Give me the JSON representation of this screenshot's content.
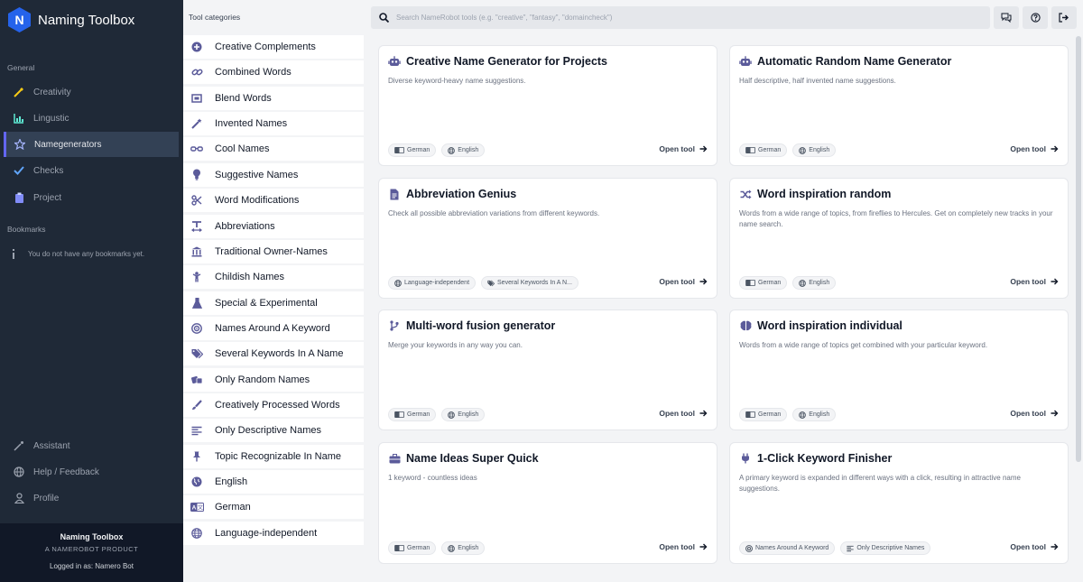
{
  "sidebar": {
    "app_name": "Naming Toolbox",
    "logo_letter": "N",
    "sections": {
      "general": "General",
      "bookmarks": "Bookmarks"
    },
    "nav": [
      {
        "label": "Creativity",
        "icon": "wand-icon"
      },
      {
        "label": "Lingustic",
        "icon": "chart-icon"
      },
      {
        "label": "Namegenerators",
        "icon": "star-icon",
        "active": true
      },
      {
        "label": "Checks",
        "icon": "check-icon"
      },
      {
        "label": "Project",
        "icon": "clipboard-icon"
      }
    ],
    "bookmarks_empty": "You do not have any bookmarks yet.",
    "bottom_nav": [
      {
        "label": "Assistant",
        "icon": "magic-icon"
      },
      {
        "label": "Help / Feedback",
        "icon": "globe-icon"
      },
      {
        "label": "Profile",
        "icon": "user-icon"
      }
    ],
    "footer": {
      "title": "Naming Toolbox",
      "subtitle": "A NAMEROBOT PRODUCT",
      "logged_in": "Logged in as: Namero Bot"
    }
  },
  "categories": {
    "heading": "Tool categories",
    "items": [
      {
        "label": "Creative Complements",
        "icon": "plus-circle-icon"
      },
      {
        "label": "Combined Words",
        "icon": "link-icon"
      },
      {
        "label": "Blend Words",
        "icon": "blend-icon"
      },
      {
        "label": "Invented Names",
        "icon": "magic-wand-icon"
      },
      {
        "label": "Cool Names",
        "icon": "glasses-icon"
      },
      {
        "label": "Suggestive Names",
        "icon": "lightbulb-icon"
      },
      {
        "label": "Word Modifications",
        "icon": "scissors-icon"
      },
      {
        "label": "Abbreviations",
        "icon": "text-width-icon"
      },
      {
        "label": "Traditional Owner-Names",
        "icon": "landmark-icon"
      },
      {
        "label": "Childish Names",
        "icon": "child-icon"
      },
      {
        "label": "Special & Experimental",
        "icon": "flask-icon"
      },
      {
        "label": "Names Around A Keyword",
        "icon": "bullseye-icon"
      },
      {
        "label": "Several Keywords In A Name",
        "icon": "tags-icon"
      },
      {
        "label": "Only Random Names",
        "icon": "dice-icon"
      },
      {
        "label": "Creatively Processed Words",
        "icon": "paintbrush-icon"
      },
      {
        "label": "Only Descriptive Names",
        "icon": "align-left-icon"
      },
      {
        "label": "Topic Recognizable In Name",
        "icon": "thumbtack-icon"
      },
      {
        "label": "English",
        "icon": "globe-americas-icon"
      },
      {
        "label": "German",
        "icon": "language-icon"
      },
      {
        "label": "Language-independent",
        "icon": "globe-icon"
      }
    ]
  },
  "search": {
    "placeholder": "Search NameRobot tools (e.g. \"creative\", \"fantasy\", \"domaincheck\")"
  },
  "open_label": "Open tool",
  "cards": [
    {
      "title": "Creative Name Generator for Projects",
      "icon": "robot-icon",
      "desc": "Diverse keyword-heavy name suggestions.",
      "tags": [
        {
          "label": "German",
          "icon": "language-icon"
        },
        {
          "label": "English",
          "icon": "globe-icon"
        }
      ]
    },
    {
      "title": "Automatic Random Name Generator",
      "icon": "robot-icon",
      "desc": "Half descriptive, half invented name suggestions.",
      "tags": [
        {
          "label": "German",
          "icon": "language-icon"
        },
        {
          "label": "English",
          "icon": "globe-icon"
        }
      ]
    },
    {
      "title": "Abbreviation Genius",
      "icon": "file-icon",
      "desc": "Check all possible abbreviation variations from different keywords.",
      "tags": [
        {
          "label": "Language-independent",
          "icon": "globe-icon"
        },
        {
          "label": "Several Keywords In A N...",
          "icon": "tags-icon"
        }
      ]
    },
    {
      "title": "Word inspiration random",
      "icon": "shuffle-icon",
      "desc": "Words from a wide range of topics, from fireflies to Hercules. Get on completely new tracks in your name search.",
      "tags": [
        {
          "label": "German",
          "icon": "language-icon"
        },
        {
          "label": "English",
          "icon": "globe-icon"
        }
      ]
    },
    {
      "title": "Multi-word fusion generator",
      "icon": "code-branch-icon",
      "desc": "Merge your keywords in any way you can.",
      "tags": [
        {
          "label": "German",
          "icon": "language-icon"
        },
        {
          "label": "English",
          "icon": "globe-icon"
        }
      ]
    },
    {
      "title": "Word inspiration individual",
      "icon": "brain-icon",
      "desc": "Words from a wide range of topics get combined with your particular keyword.",
      "tags": [
        {
          "label": "German",
          "icon": "language-icon"
        },
        {
          "label": "English",
          "icon": "globe-icon"
        }
      ]
    },
    {
      "title": "Name Ideas Super Quick",
      "icon": "briefcase-icon",
      "desc": "1 keyword - countless ideas",
      "tags": [
        {
          "label": "German",
          "icon": "language-icon"
        },
        {
          "label": "English",
          "icon": "globe-icon"
        }
      ]
    },
    {
      "title": "1-Click Keyword Finisher",
      "icon": "plug-icon",
      "desc": "A primary keyword is expanded in different ways with a click, resulting in attractive name suggestions.",
      "tags": [
        {
          "label": "Names Around A Keyword",
          "icon": "bullseye-icon"
        },
        {
          "label": "Only Descriptive Names",
          "icon": "align-left-icon"
        }
      ]
    }
  ],
  "colors": {
    "sidebar_bg": "#1f2937",
    "accent": "#6366f1",
    "icon_purple": "#5b5b9a"
  }
}
